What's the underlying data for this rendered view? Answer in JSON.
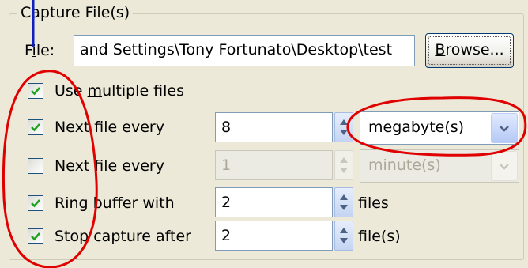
{
  "group_title": "Capture File(s)",
  "file": {
    "label_first": "F",
    "label_underlined": "i",
    "label_rest": "le:",
    "value": "and Settings\\Tony Fortunato\\Desktop\\test",
    "browse_first": "",
    "browse_underlined": "B",
    "browse_rest": "rowse..."
  },
  "use_multiple": {
    "label_first": "Use ",
    "label_underlined": "m",
    "label_rest": "ultiple files",
    "checked": true
  },
  "next_file_size": {
    "label": "Next file every",
    "checked": true,
    "value": "8",
    "unit": "megabyte(s)"
  },
  "next_file_time": {
    "label": "Next file every",
    "checked": false,
    "value": "1",
    "unit": "minute(s)"
  },
  "ring_buffer": {
    "label": "Ring buffer with",
    "checked": true,
    "value": "2",
    "unit": "files"
  },
  "stop_capture": {
    "label": "Stop capture after",
    "checked": true,
    "value": "2",
    "unit": "file(s)"
  },
  "colors": {
    "annotation_red": "#e00000",
    "annotation_blue": "#1020c0",
    "checkmark_green": "#21a121"
  }
}
